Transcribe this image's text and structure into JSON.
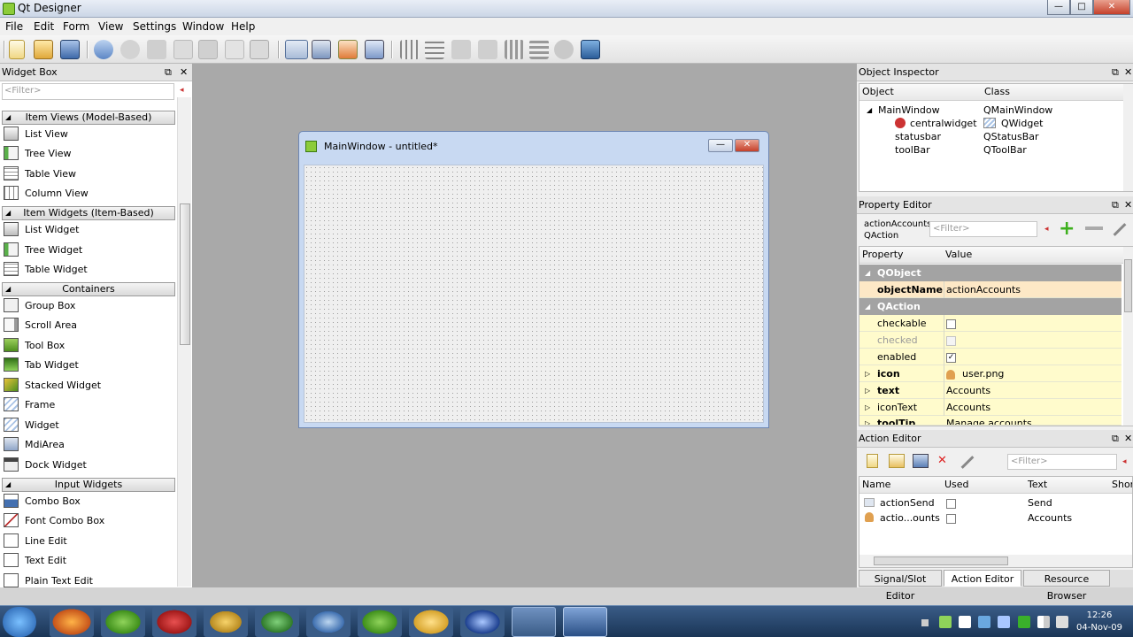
{
  "window": {
    "title": "Qt Designer",
    "min": "—",
    "max": "□",
    "close": "✕"
  },
  "menu": [
    "File",
    "Edit",
    "Form",
    "View",
    "Settings",
    "Window",
    "Help"
  ],
  "toolbar_icons": [
    "new-icon",
    "open-icon",
    "save-icon",
    "undo-icon",
    "redo-icon",
    "cut-icon",
    "copy-icon",
    "paste-icon",
    "lower-icon",
    "raise-icon",
    "edit-widgets-icon",
    "edit-signals-icon",
    "edit-buddies-icon",
    "edit-tab-order-icon",
    "layout-horizontal-icon",
    "layout-vertical-icon",
    "layout-h-splitter-icon",
    "layout-v-splitter-icon",
    "layout-grid-icon",
    "layout-form-icon",
    "break-layout-icon",
    "adjust-size-icon"
  ],
  "widget_box": {
    "title": "Widget Box",
    "filter": "<Filter>",
    "categories": [
      "Item Views (Model-Based)",
      "Item Widgets (Item-Based)",
      "Containers",
      "Input Widgets"
    ],
    "item_views": [
      "List View",
      "Tree View",
      "Table View",
      "Column View"
    ],
    "item_widgets": [
      "List Widget",
      "Tree Widget",
      "Table Widget"
    ],
    "containers": [
      "Group Box",
      "Scroll Area",
      "Tool Box",
      "Tab Widget",
      "Stacked Widget",
      "Frame",
      "Widget",
      "MdiArea",
      "Dock Widget"
    ],
    "input_widgets": [
      "Combo Box",
      "Font Combo Box",
      "Line Edit",
      "Text Edit",
      "Plain Text Edit"
    ]
  },
  "form": {
    "title": "MainWindow - untitled*",
    "min": "—",
    "close": "✕"
  },
  "object_inspector": {
    "title": "Object Inspector",
    "col_object": "Object",
    "col_class": "Class",
    "rows": [
      {
        "obj": "MainWindow",
        "cls": "QMainWindow"
      },
      {
        "obj": "centralwidget",
        "cls": "QWidget"
      },
      {
        "obj": "statusbar",
        "cls": "QStatusBar"
      },
      {
        "obj": "toolBar",
        "cls": "QToolBar"
      }
    ]
  },
  "property_editor": {
    "title": "Property Editor",
    "object_name": "actionAccounts",
    "object_class": "QAction",
    "filter": "<Filter>",
    "col_property": "Property",
    "col_value": "Value",
    "group_qobject": "QObject",
    "group_qaction": "QAction",
    "rows": [
      {
        "name": "objectName",
        "value": "actionAccounts"
      },
      {
        "name": "checkable",
        "value": ""
      },
      {
        "name": "checked",
        "value": ""
      },
      {
        "name": "enabled",
        "value": "✓"
      },
      {
        "name": "icon",
        "value": "user.png"
      },
      {
        "name": "text",
        "value": "Accounts"
      },
      {
        "name": "iconText",
        "value": "Accounts"
      },
      {
        "name": "toolTip",
        "value": "Manage accounts"
      }
    ]
  },
  "action_editor": {
    "title": "Action Editor",
    "filter": "<Filter>",
    "cols": [
      "Name",
      "Used",
      "Text",
      "Shor"
    ],
    "rows": [
      {
        "name": "actionSend",
        "text": "Send"
      },
      {
        "name": "actio...ounts",
        "text": "Accounts"
      }
    ]
  },
  "tabs": [
    "Signal/Slot Editor",
    "Action Editor",
    "Resource Browser"
  ],
  "tray": {
    "time": "12:26",
    "date": "04-Nov-09"
  },
  "colors": {
    "menu": "#f0f0f0",
    "mdi": "#a9a9a9",
    "taskbar": "#1a3556",
    "prop_yellow": "#fffbcc",
    "prop_orange": "#fde8c6"
  }
}
